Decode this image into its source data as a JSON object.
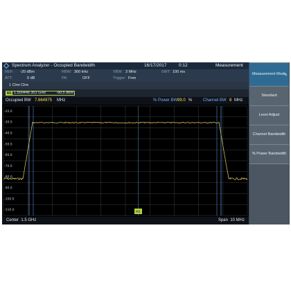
{
  "window": {
    "title": "Spectrum Analyzer - Occupied Bandwidth",
    "date": "16/17/2017",
    "time": "0:12",
    "measurement": "Measurement"
  },
  "params": {
    "ref_label": "REF:",
    "ref_value": "-20 dBm",
    "rbw_label": "RBW:",
    "rbw_value": "300 kHz",
    "vbw_label": "VBW:",
    "vbw_value": "3 MHz",
    "swt_label": "SWT:",
    "swt_value": "100 ms",
    "att_label": "ATT:",
    "att_value": "0 dB",
    "pa_label": "PA:",
    "pa_value": "OFF",
    "trigger_label": "Trigger:",
    "trigger_value": "Free"
  },
  "trace": {
    "label": "1 Clrw  Clrw"
  },
  "marker": {
    "tag": "M1",
    "frequency": "1.500446 301  GHz",
    "level": "-90.5  dBm"
  },
  "results": {
    "occ_bw_label": "Occupied BW",
    "occ_bw_value": "7.664975",
    "occ_bw_unit": "MHz",
    "pct_power_label": "% Power BW",
    "pct_power_value": "99.0",
    "pct_power_unit": "%",
    "channel_bw_label": "Channel BW",
    "channel_bw_value": "8",
    "channel_bw_unit": "MHz"
  },
  "graph": {
    "y_labels": [
      "-20.0",
      "-30.0",
      "-40.0",
      "-50.0",
      "-60.0",
      "-70.0",
      "-80.0",
      "-90.0",
      "-100.0",
      "-110.0"
    ],
    "marker_flag": "M1",
    "trace_color": "#e8d460",
    "line_color": "#5a8fd0"
  },
  "footer": {
    "center_label": "Center",
    "center_value": "1.5 GHz",
    "span_label": "Span",
    "span_value": "10 MHz"
  },
  "softkeys": [
    {
      "label": "Measurement Mode",
      "active": true,
      "icon": "chevron-right-icon"
    },
    {
      "label": "Standard",
      "active": false
    },
    {
      "label": "Level Adjust",
      "active": false
    },
    {
      "label": "Channel Bandwidth",
      "active": false
    },
    {
      "label": "% Power Bandwidth",
      "active": false
    }
  ]
}
